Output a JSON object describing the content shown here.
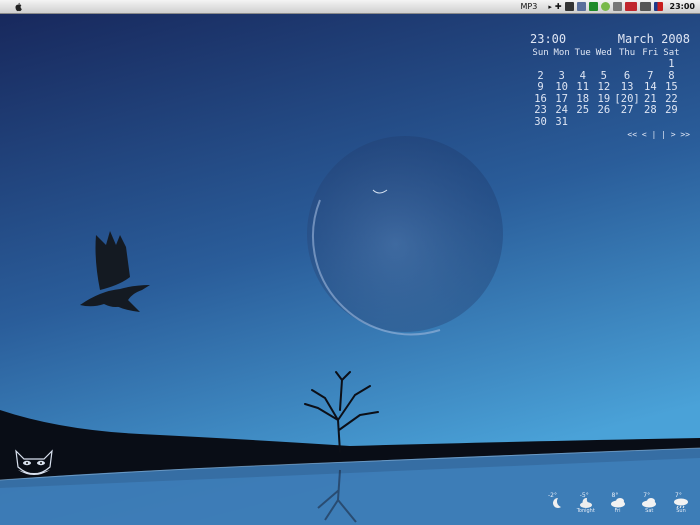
{
  "menubar": {
    "mp3_label": "MP3",
    "clock": "23:00",
    "tray_icons": [
      "arrow-icon",
      "plus-icon",
      "flag-icon",
      "network-icon",
      "green-app-icon",
      "drop-icon",
      "user-icon",
      "ati-icon",
      "monitor-icon",
      "flag-us-icon"
    ]
  },
  "calendar": {
    "time": "23:00",
    "month_year": "March 2008",
    "weekdays": [
      "Sun",
      "Mon",
      "Tue",
      "Wed",
      "Thu",
      "Fri",
      "Sat"
    ],
    "weeks": [
      [
        "",
        "",
        "",
        "",
        "",
        "",
        "1"
      ],
      [
        "2",
        "3",
        "4",
        "5",
        "6",
        "7",
        "8"
      ],
      [
        "9",
        "10",
        "11",
        "12",
        "13",
        "14",
        "15"
      ],
      [
        "16",
        "17",
        "18",
        "19",
        "[20]",
        "21",
        "22"
      ],
      [
        "23",
        "24",
        "25",
        "26",
        "27",
        "28",
        "29"
      ],
      [
        "30",
        "31",
        "",
        "",
        "",
        "",
        ""
      ]
    ],
    "nav": "<< < | | > >>"
  },
  "weather": [
    {
      "temp": "-2°",
      "label": "",
      "icon": "moon-icon"
    },
    {
      "temp": "-5°",
      "label": "Tonight",
      "icon": "cloud-moon-icon"
    },
    {
      "temp": "8°",
      "label": "Fri",
      "icon": "cloudy-icon"
    },
    {
      "temp": "7°",
      "label": "Sat",
      "icon": "cloudy-icon"
    },
    {
      "temp": "7°",
      "label": "Sun",
      "icon": "rain-cloud-icon"
    }
  ],
  "colors": {
    "sky_top": "#16244f",
    "sky_bottom": "#3f8fc9",
    "ground": "#0c0f18"
  }
}
